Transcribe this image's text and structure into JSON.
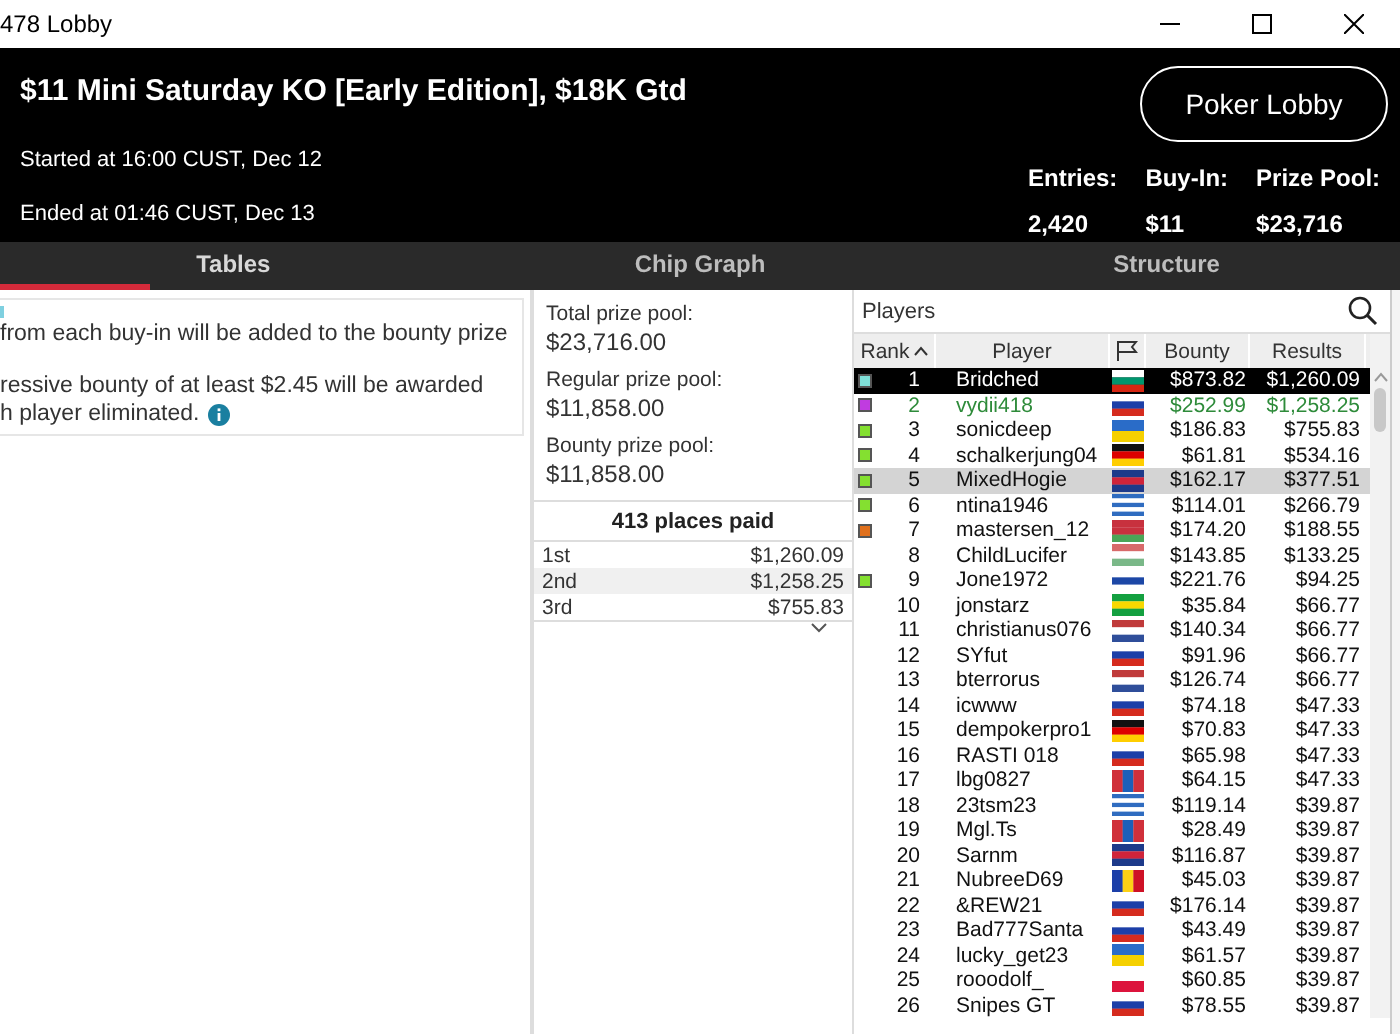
{
  "window": {
    "title": "478 Lobby"
  },
  "header": {
    "title": "$11 Mini Saturday KO [Early Edition], $18K Gtd",
    "started": "Started at 16:00 CUST, Dec 12",
    "ended": "Ended at 01:46 CUST, Dec 13",
    "button": "Poker Lobby",
    "stats": [
      {
        "label": "Entries:",
        "value": "2,420"
      },
      {
        "label": "Buy-In:",
        "value": "$11"
      },
      {
        "label": "Prize Pool:",
        "value": "$23,716"
      }
    ]
  },
  "tabs": [
    {
      "label": "Tables",
      "selected": true
    },
    {
      "label": "Chip Graph",
      "selected": false
    },
    {
      "label": "Structure",
      "selected": false
    }
  ],
  "info_card": {
    "lines": [
      "from each buy-in will be added to the bounty prize",
      "ressive bounty of at least $2.45 will be awarded",
      "h player eliminated."
    ]
  },
  "prize_pools": [
    {
      "label": "Total prize pool:",
      "value": "$23,716.00"
    },
    {
      "label": "Regular prize pool:",
      "value": "$11,858.00"
    },
    {
      "label": "Bounty prize pool:",
      "value": "$11,858.00"
    }
  ],
  "payouts": {
    "title": "413 places paid",
    "rows": [
      {
        "place": "1st",
        "amount": "$1,260.09"
      },
      {
        "place": "2nd",
        "amount": "$1,258.25"
      },
      {
        "place": "3rd",
        "amount": "$755.83"
      }
    ]
  },
  "players": {
    "title": "Players",
    "columns": [
      "Rank",
      "Player",
      "Bounty",
      "Results"
    ],
    "rows": [
      {
        "rank": "1",
        "name": "Bridched",
        "bounty": "$873.82",
        "result": "$1,260.09",
        "color": "#7fe0d8",
        "selected": true,
        "hovered": false,
        "own": false,
        "flag": {
          "kind": "bg"
        }
      },
      {
        "rank": "2",
        "name": "vydii418",
        "bounty": "$252.99",
        "result": "$1,258.25",
        "color": "#c03ce0",
        "selected": false,
        "hovered": false,
        "own": true,
        "flag": {
          "kind": "ru"
        }
      },
      {
        "rank": "3",
        "name": "sonicdeep",
        "bounty": "$186.83",
        "result": "$755.83",
        "color": "#84e030",
        "selected": false,
        "hovered": false,
        "own": false,
        "flag": {
          "kind": "ua"
        }
      },
      {
        "rank": "4",
        "name": "schalkerjung04",
        "bounty": "$61.81",
        "result": "$534.16",
        "color": "#84e030",
        "selected": false,
        "hovered": false,
        "own": false,
        "flag": {
          "kind": "de"
        }
      },
      {
        "rank": "5",
        "name": "MixedHogie",
        "bounty": "$162.17",
        "result": "$377.51",
        "color": "#84e030",
        "selected": false,
        "hovered": true,
        "own": false,
        "flag": {
          "kind": "gb"
        }
      },
      {
        "rank": "6",
        "name": "ntina1946",
        "bounty": "$114.01",
        "result": "$266.79",
        "color": "#84e030",
        "selected": false,
        "hovered": false,
        "own": false,
        "flag": {
          "kind": "gr"
        }
      },
      {
        "rank": "7",
        "name": "mastersen_12",
        "bounty": "$174.20",
        "result": "$188.55",
        "color": "#e0701c",
        "selected": false,
        "hovered": false,
        "own": false,
        "flag": {
          "kind": "by"
        }
      },
      {
        "rank": "8",
        "name": "ChildLucifer",
        "bounty": "$143.85",
        "result": "$133.25",
        "selected": false,
        "hovered": false,
        "own": false,
        "flag": {
          "kind": "hu"
        }
      },
      {
        "rank": "9",
        "name": "Jone1972",
        "bounty": "$221.76",
        "result": "$94.25",
        "color": "#84e030",
        "selected": false,
        "hovered": false,
        "own": false,
        "flag": {
          "kind": "fi"
        }
      },
      {
        "rank": "10",
        "name": "jonstarz",
        "bounty": "$35.84",
        "result": "$66.77",
        "selected": false,
        "hovered": false,
        "own": false,
        "flag": {
          "kind": "br"
        }
      },
      {
        "rank": "11",
        "name": "christianus076",
        "bounty": "$140.34",
        "result": "$66.77",
        "selected": false,
        "hovered": false,
        "own": false,
        "flag": {
          "kind": "nl"
        }
      },
      {
        "rank": "12",
        "name": "SYfut",
        "bounty": "$91.96",
        "result": "$66.77",
        "selected": false,
        "hovered": false,
        "own": false,
        "flag": {
          "kind": "ru"
        }
      },
      {
        "rank": "13",
        "name": "bterrorus",
        "bounty": "$126.74",
        "result": "$66.77",
        "selected": false,
        "hovered": false,
        "own": false,
        "flag": {
          "kind": "nl"
        }
      },
      {
        "rank": "14",
        "name": "icwww",
        "bounty": "$74.18",
        "result": "$47.33",
        "selected": false,
        "hovered": false,
        "own": false,
        "flag": {
          "kind": "ru"
        }
      },
      {
        "rank": "15",
        "name": "dempokerpro1",
        "bounty": "$70.83",
        "result": "$47.33",
        "selected": false,
        "hovered": false,
        "own": false,
        "flag": {
          "kind": "de"
        }
      },
      {
        "rank": "16",
        "name": "RASTI 018",
        "bounty": "$65.98",
        "result": "$47.33",
        "selected": false,
        "hovered": false,
        "own": false,
        "flag": {
          "kind": "ru"
        }
      },
      {
        "rank": "17",
        "name": "lbg0827",
        "bounty": "$64.15",
        "result": "$47.33",
        "selected": false,
        "hovered": false,
        "own": false,
        "flag": {
          "kind": "mn"
        }
      },
      {
        "rank": "18",
        "name": "23tsm23",
        "bounty": "$119.14",
        "result": "$39.87",
        "selected": false,
        "hovered": false,
        "own": false,
        "flag": {
          "kind": "gr"
        }
      },
      {
        "rank": "19",
        "name": "Mgl.Ts",
        "bounty": "$28.49",
        "result": "$39.87",
        "selected": false,
        "hovered": false,
        "own": false,
        "flag": {
          "kind": "mn"
        }
      },
      {
        "rank": "20",
        "name": "Sarnm",
        "bounty": "$116.87",
        "result": "$39.87",
        "selected": false,
        "hovered": false,
        "own": false,
        "flag": {
          "kind": "gb"
        }
      },
      {
        "rank": "21",
        "name": "NubreeD69",
        "bounty": "$45.03",
        "result": "$39.87",
        "selected": false,
        "hovered": false,
        "own": false,
        "flag": {
          "kind": "ro"
        }
      },
      {
        "rank": "22",
        "name": "&REW21",
        "bounty": "$176.14",
        "result": "$39.87",
        "selected": false,
        "hovered": false,
        "own": false,
        "flag": {
          "kind": "ru"
        }
      },
      {
        "rank": "23",
        "name": "Bad777Santa",
        "bounty": "$43.49",
        "result": "$39.87",
        "selected": false,
        "hovered": false,
        "own": false,
        "flag": {
          "kind": "ru"
        }
      },
      {
        "rank": "24",
        "name": "lucky_get23",
        "bounty": "$61.57",
        "result": "$39.87",
        "selected": false,
        "hovered": false,
        "own": false,
        "flag": {
          "kind": "ua"
        }
      },
      {
        "rank": "25",
        "name": "rooodolf_",
        "bounty": "$60.85",
        "result": "$39.87",
        "selected": false,
        "hovered": false,
        "own": false,
        "flag": {
          "kind": "pl"
        }
      },
      {
        "rank": "26",
        "name": "Snipes GT",
        "bounty": "$78.55",
        "result": "$39.87",
        "selected": false,
        "hovered": false,
        "own": false,
        "flag": {
          "kind": "ru"
        }
      }
    ]
  }
}
